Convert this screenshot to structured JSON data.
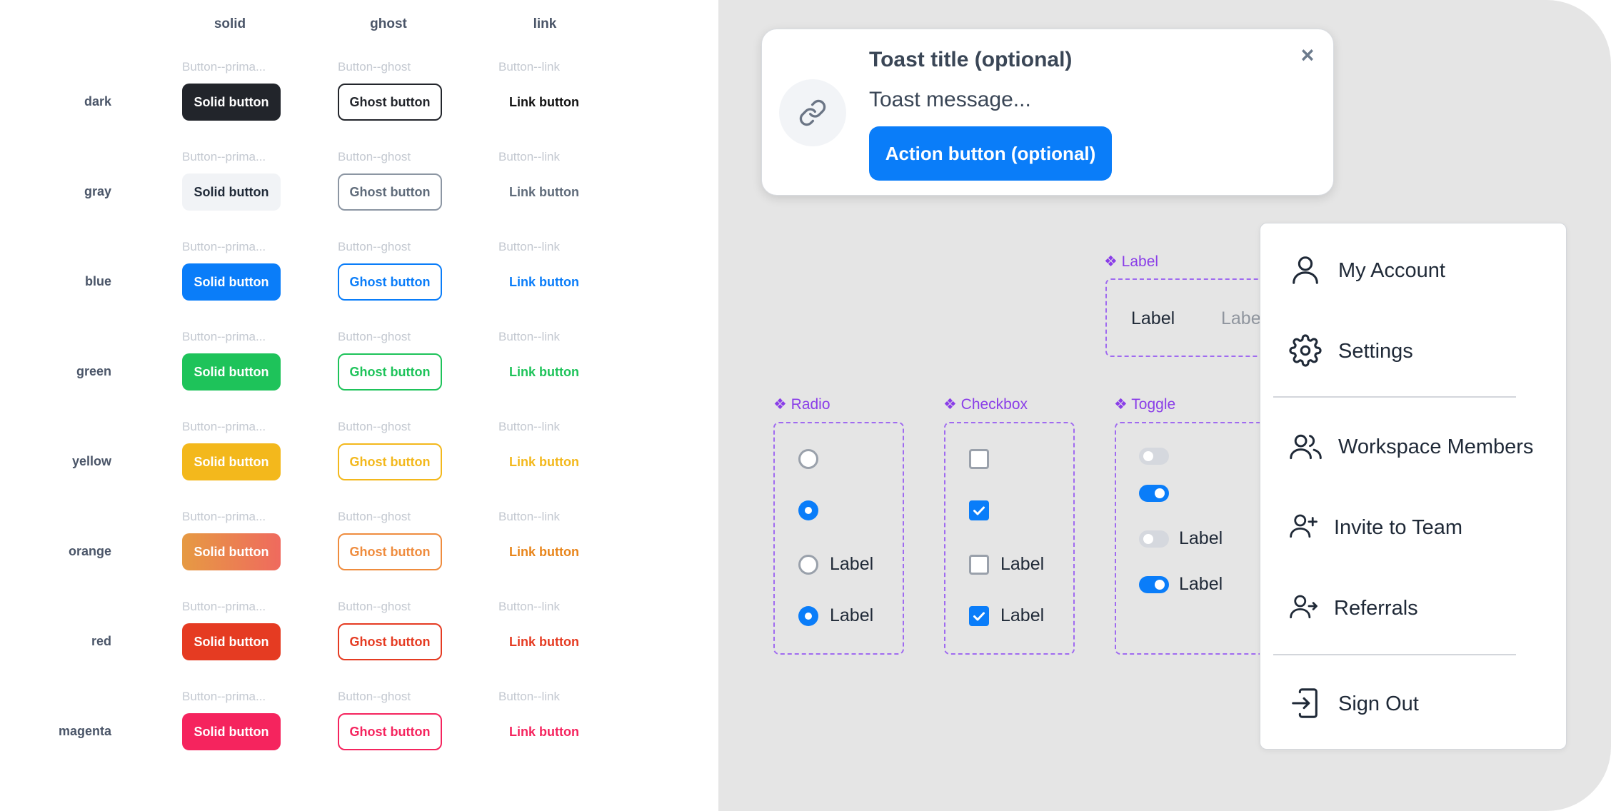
{
  "grid": {
    "columns": [
      "solid",
      "ghost",
      "link"
    ],
    "captions": {
      "solid": "Button--prima...",
      "ghost": "Button--ghost",
      "link": "Button--link"
    },
    "rows": [
      {
        "name": "dark",
        "solid": "Solid button",
        "ghost": "Ghost button",
        "link": "Link button"
      },
      {
        "name": "gray",
        "solid": "Solid button",
        "ghost": "Ghost button",
        "link": "Link button"
      },
      {
        "name": "blue",
        "solid": "Solid button",
        "ghost": "Ghost button",
        "link": "Link button"
      },
      {
        "name": "green",
        "solid": "Solid button",
        "ghost": "Ghost button",
        "link": "Link button"
      },
      {
        "name": "yellow",
        "solid": "Solid button",
        "ghost": "Ghost button",
        "link": "Link button"
      },
      {
        "name": "orange",
        "solid": "Solid button",
        "ghost": "Ghost button",
        "link": "Link button"
      },
      {
        "name": "red",
        "solid": "Solid button",
        "ghost": "Ghost button",
        "link": "Link button"
      },
      {
        "name": "magenta",
        "solid": "Solid button",
        "ghost": "Ghost button",
        "link": "Link button"
      }
    ]
  },
  "colors": {
    "dark": "#22252b",
    "gray": "#f1f3f6",
    "blue": "#0a7df9",
    "green": "#1ec35a",
    "yellow": "#f3b81c",
    "orange": "#ef8c3e",
    "red": "#e53b22",
    "magenta": "#f5245e",
    "toast_action": "#0a7df9",
    "component_purple": "#8a3ee8"
  },
  "toast": {
    "title": "Toast title (optional)",
    "message": "Toast message...",
    "action": "Action button (optional)",
    "icon": "link-icon",
    "close": "×"
  },
  "label_component": {
    "tag": "❖ Label",
    "items": [
      "Label",
      "Labe"
    ]
  },
  "radio": {
    "tag": "❖ Radio",
    "items": [
      {
        "checked": false,
        "label": ""
      },
      {
        "checked": true,
        "label": ""
      },
      {
        "checked": false,
        "label": "Label"
      },
      {
        "checked": true,
        "label": "Label"
      }
    ]
  },
  "checkbox": {
    "tag": "❖ Checkbox",
    "items": [
      {
        "checked": false,
        "label": ""
      },
      {
        "checked": true,
        "label": ""
      },
      {
        "checked": false,
        "label": "Label"
      },
      {
        "checked": true,
        "label": "Label"
      }
    ]
  },
  "toggle": {
    "tag": "❖ Toggle",
    "items": [
      {
        "on": false,
        "label": ""
      },
      {
        "on": true,
        "label": ""
      },
      {
        "on": false,
        "label": "Label"
      },
      {
        "on": true,
        "label": "Label"
      }
    ]
  },
  "menu": {
    "items": [
      {
        "label": "My Account",
        "icon": "user-icon"
      },
      {
        "label": "Settings",
        "icon": "gear-icon"
      },
      {
        "label": "Workspace Members",
        "icon": "users-icon"
      },
      {
        "label": "Invite to Team",
        "icon": "user-plus-icon"
      },
      {
        "label": "Referrals",
        "icon": "user-arrow-icon"
      },
      {
        "label": "Sign Out",
        "icon": "sign-out-icon"
      }
    ]
  }
}
